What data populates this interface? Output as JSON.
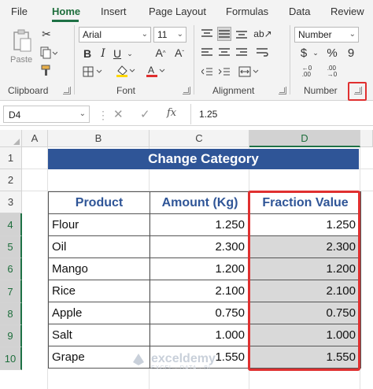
{
  "ribbon_tabs": [
    "File",
    "Home",
    "Insert",
    "Page Layout",
    "Formulas",
    "Data",
    "Review"
  ],
  "active_tab": "Home",
  "clipboard": {
    "paste_label": "Paste",
    "group_label": "Clipboard"
  },
  "font": {
    "family": "Arial",
    "size": "11",
    "group_label": "Font",
    "bold": "B",
    "italic": "I",
    "underline": "U"
  },
  "alignment": {
    "group_label": "Alignment"
  },
  "number": {
    "format": "Number",
    "currency": "$",
    "percent": "%",
    "comma": "9",
    "group_label": "Number"
  },
  "formula_bar": {
    "name_box": "D4",
    "formula": "1.25"
  },
  "columns": [
    "A",
    "B",
    "C",
    "D"
  ],
  "rows": [
    "1",
    "2",
    "3",
    "4",
    "5",
    "6",
    "7",
    "8",
    "9",
    "10"
  ],
  "title": "Change Category",
  "table": {
    "headers": [
      "Product",
      "Amount (Kg)",
      "Fraction Value"
    ],
    "rows": [
      [
        "Flour",
        "1.250",
        "1.250"
      ],
      [
        "Oil",
        "2.300",
        "2.300"
      ],
      [
        "Mango",
        "1.200",
        "1.200"
      ],
      [
        "Rice",
        "2.100",
        "2.100"
      ],
      [
        "Apple",
        "0.750",
        "0.750"
      ],
      [
        "Salt",
        "1.000",
        "1.000"
      ],
      [
        "Grape",
        "1.550",
        "1.550"
      ]
    ]
  },
  "watermark": {
    "name": "exceldemy",
    "tagline": "EXCEL · DATA · BI"
  },
  "colors": {
    "accent": "#1e7145",
    "title_fill": "#2f5597",
    "highlight": "#e03030",
    "selected_fill": "#d9d9d9"
  }
}
